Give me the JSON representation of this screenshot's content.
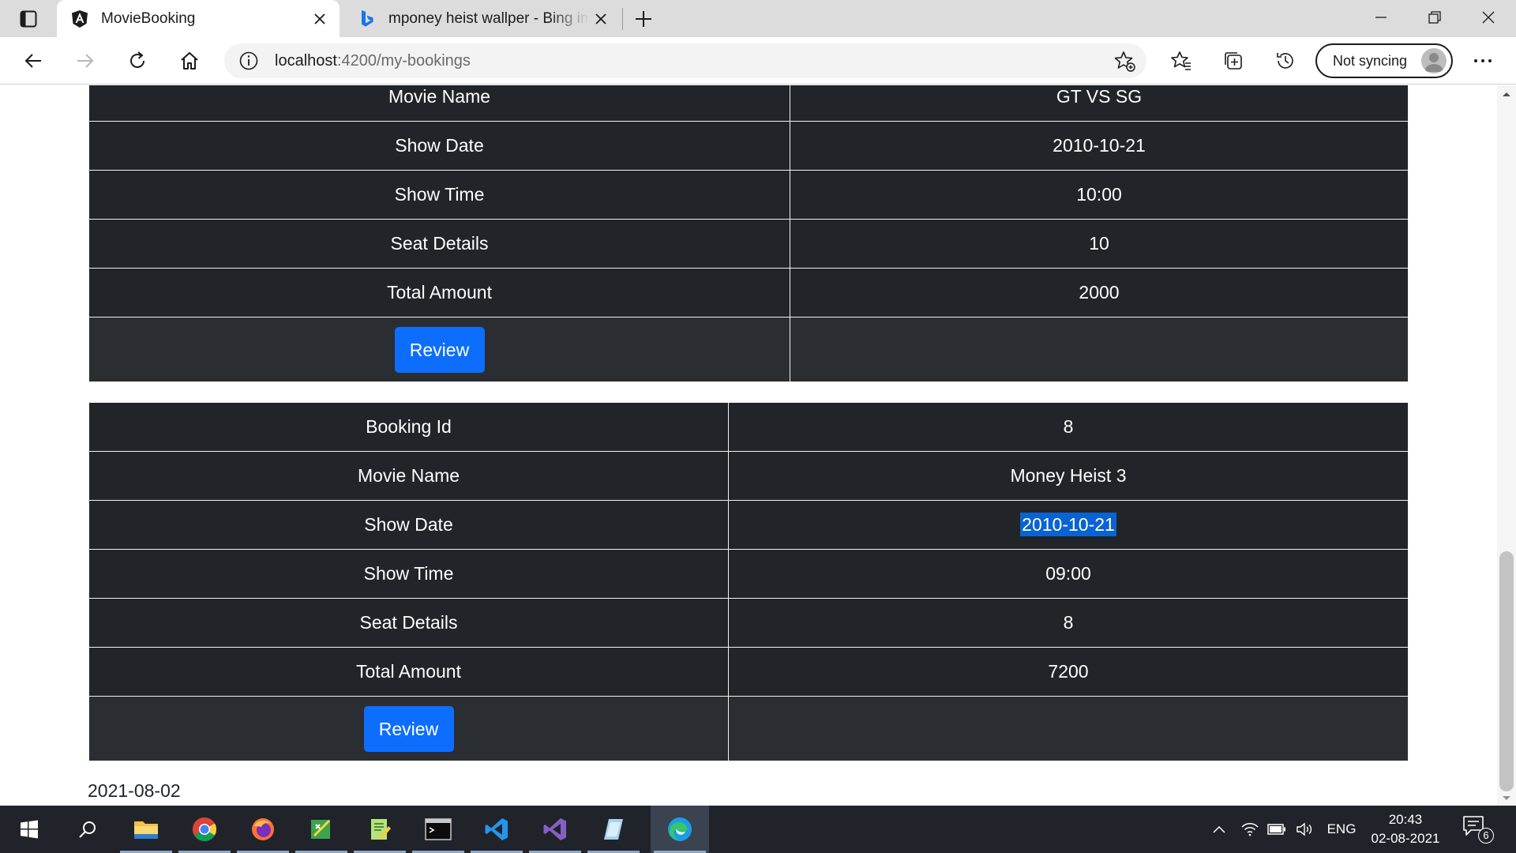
{
  "browser": {
    "tabs": [
      {
        "title": "MovieBooking",
        "icon": "angular-icon"
      },
      {
        "title": "mponey heist wallper - Bing ima",
        "icon": "bing-icon"
      }
    ],
    "address": {
      "host": "localhost",
      "path": ":4200/my-bookings"
    },
    "sync_label": "Not syncing"
  },
  "bookings": [
    {
      "rows": [
        {
          "label": "Movie Name",
          "value": "GT VS SG"
        },
        {
          "label": "Show Date",
          "value": "2010-10-21"
        },
        {
          "label": "Show Time",
          "value": "10:00"
        },
        {
          "label": "Seat Details",
          "value": "10"
        },
        {
          "label": "Total Amount",
          "value": "2000"
        }
      ],
      "review_label": "Review"
    },
    {
      "rows": [
        {
          "label": "Booking Id",
          "value": "8"
        },
        {
          "label": "Movie Name",
          "value": "Money Heist 3"
        },
        {
          "label": "Show Date",
          "value": "2010-10-21"
        },
        {
          "label": "Show Time",
          "value": "09:00"
        },
        {
          "label": "Seat Details",
          "value": "8"
        },
        {
          "label": "Total Amount",
          "value": "7200"
        }
      ],
      "review_label": "Review"
    }
  ],
  "page_footer_date": "2021-08-02",
  "taskbar": {
    "apps": [
      "file-explorer",
      "chrome",
      "firefox",
      "app-green",
      "notepad-plus",
      "terminal",
      "vscode",
      "visual-studio",
      "azure-data-studio",
      "edge"
    ],
    "language": "ENG",
    "time": "20:43",
    "date": "02-08-2021",
    "notification_count": "6"
  }
}
